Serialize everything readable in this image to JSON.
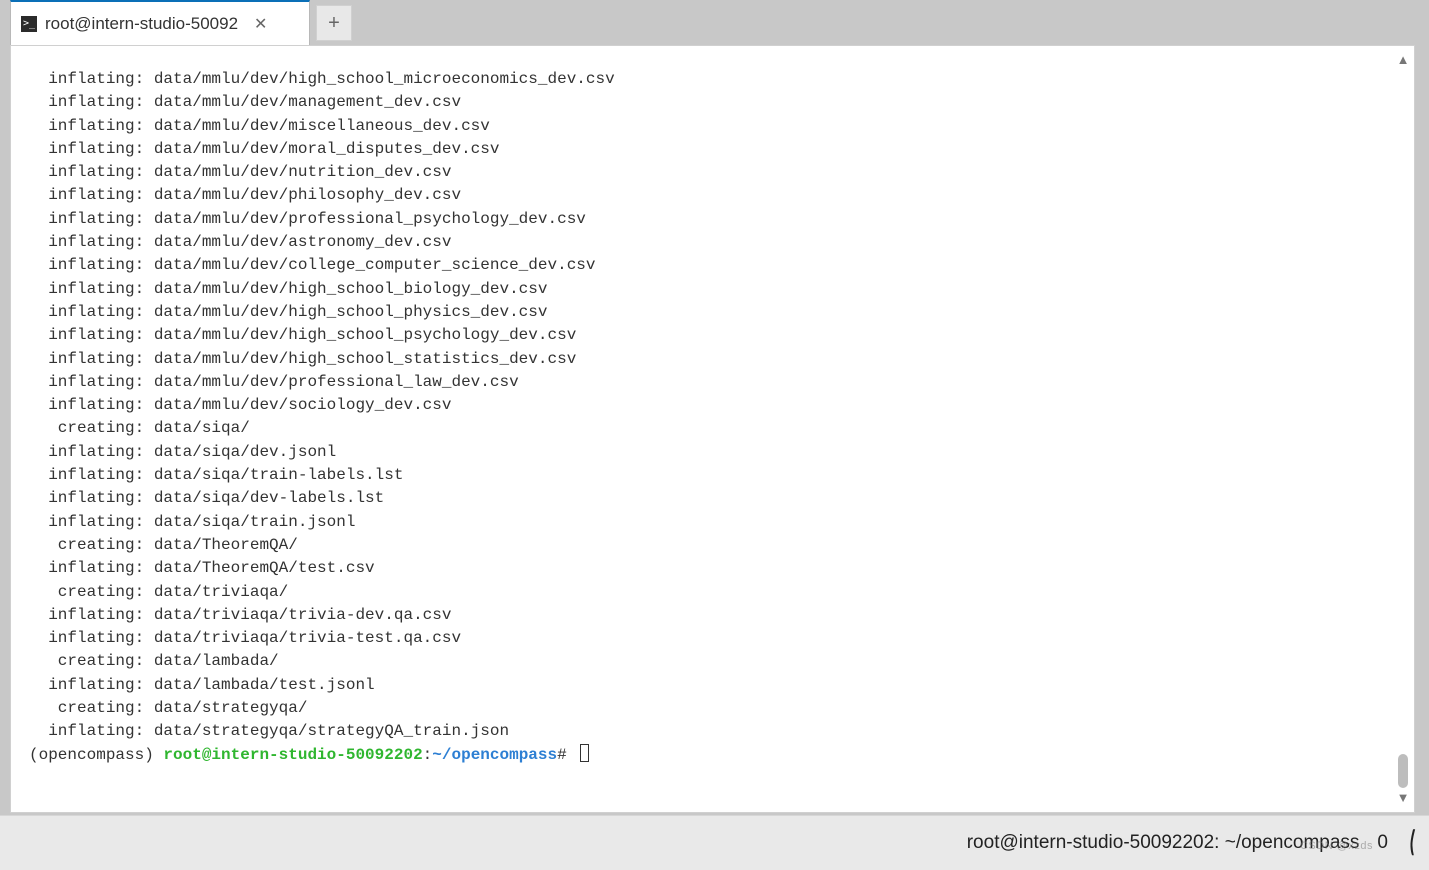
{
  "tab": {
    "title": "root@intern-studio-50092",
    "icon_label": ">_"
  },
  "newtab_glyph": "+",
  "close_glyph": "✕",
  "terminal": {
    "lines": [
      {
        "label": "inflating:",
        "path": "data/mmlu/dev/high_school_microeconomics_dev.csv"
      },
      {
        "label": "inflating:",
        "path": "data/mmlu/dev/management_dev.csv"
      },
      {
        "label": "inflating:",
        "path": "data/mmlu/dev/miscellaneous_dev.csv"
      },
      {
        "label": "inflating:",
        "path": "data/mmlu/dev/moral_disputes_dev.csv"
      },
      {
        "label": "inflating:",
        "path": "data/mmlu/dev/nutrition_dev.csv"
      },
      {
        "label": "inflating:",
        "path": "data/mmlu/dev/philosophy_dev.csv"
      },
      {
        "label": "inflating:",
        "path": "data/mmlu/dev/professional_psychology_dev.csv"
      },
      {
        "label": "inflating:",
        "path": "data/mmlu/dev/astronomy_dev.csv"
      },
      {
        "label": "inflating:",
        "path": "data/mmlu/dev/college_computer_science_dev.csv"
      },
      {
        "label": "inflating:",
        "path": "data/mmlu/dev/high_school_biology_dev.csv"
      },
      {
        "label": "inflating:",
        "path": "data/mmlu/dev/high_school_physics_dev.csv"
      },
      {
        "label": "inflating:",
        "path": "data/mmlu/dev/high_school_psychology_dev.csv"
      },
      {
        "label": "inflating:",
        "path": "data/mmlu/dev/high_school_statistics_dev.csv"
      },
      {
        "label": "inflating:",
        "path": "data/mmlu/dev/professional_law_dev.csv"
      },
      {
        "label": "inflating:",
        "path": "data/mmlu/dev/sociology_dev.csv"
      },
      {
        "label": " creating:",
        "path": "data/siqa/"
      },
      {
        "label": "inflating:",
        "path": "data/siqa/dev.jsonl"
      },
      {
        "label": "inflating:",
        "path": "data/siqa/train-labels.lst"
      },
      {
        "label": "inflating:",
        "path": "data/siqa/dev-labels.lst"
      },
      {
        "label": "inflating:",
        "path": "data/siqa/train.jsonl"
      },
      {
        "label": " creating:",
        "path": "data/TheoremQA/"
      },
      {
        "label": "inflating:",
        "path": "data/TheoremQA/test.csv"
      },
      {
        "label": " creating:",
        "path": "data/triviaqa/"
      },
      {
        "label": "inflating:",
        "path": "data/triviaqa/trivia-dev.qa.csv"
      },
      {
        "label": "inflating:",
        "path": "data/triviaqa/trivia-test.qa.csv"
      },
      {
        "label": " creating:",
        "path": "data/lambada/"
      },
      {
        "label": "inflating:",
        "path": "data/lambada/test.jsonl"
      },
      {
        "label": " creating:",
        "path": "data/strategyqa/"
      },
      {
        "label": "inflating:",
        "path": "data/strategyqa/strategyQA_train.json"
      }
    ],
    "prompt": {
      "env": "(opencompass) ",
      "userhost": "root@intern-studio-50092202",
      "colon": ":",
      "path": "~/opencompass",
      "sep": "# "
    }
  },
  "statusbar": {
    "text": "root@intern-studio-50092202: ~/opencompass",
    "count": "0",
    "bell_glyph": "⎝"
  },
  "scroll": {
    "up_glyph": "▲",
    "down_glyph": "▼"
  },
  "watermark": "CSDN @xzds"
}
